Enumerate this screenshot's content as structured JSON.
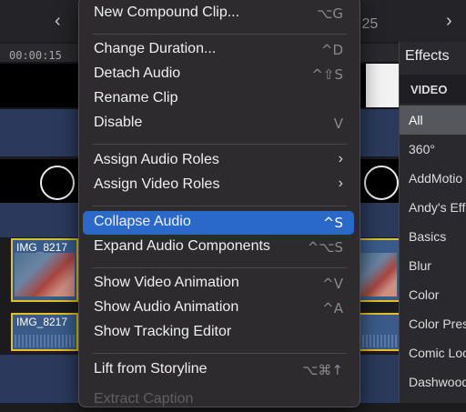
{
  "topbar": {
    "time_text": ":25"
  },
  "ruler": {
    "timecode": "00:00:15"
  },
  "clips": [
    {
      "label": "IMG_8217"
    },
    {
      "label": "IMG_8217"
    }
  ],
  "effects": {
    "title": "Effects",
    "section": "VIDEO",
    "items": [
      "All",
      "360°",
      "AddMotio",
      "Andy's Eff",
      "Basics",
      "Blur",
      "Color",
      "Color Pres",
      "Comic Loo",
      "Dashwood"
    ]
  },
  "menu": {
    "items": [
      {
        "label": "New Compound Clip...",
        "shortcut": "⌥G"
      },
      {
        "label": "Change Duration...",
        "shortcut": "^D"
      },
      {
        "label": "Detach Audio",
        "shortcut": "^⇧S"
      },
      {
        "label": "Rename Clip",
        "shortcut": ""
      },
      {
        "label": "Disable",
        "shortcut": "V"
      },
      {
        "label": "Assign Audio Roles",
        "submenu": "›"
      },
      {
        "label": "Assign Video Roles",
        "submenu": "›"
      },
      {
        "label": "Collapse Audio",
        "shortcut": "^S"
      },
      {
        "label": "Expand Audio Components",
        "shortcut": "^⌥S"
      },
      {
        "label": "Show Video Animation",
        "shortcut": "^V"
      },
      {
        "label": "Show Audio Animation",
        "shortcut": "^A"
      },
      {
        "label": "Show Tracking Editor",
        "shortcut": ""
      },
      {
        "label": "Lift from Storyline",
        "shortcut": "⌥⌘↑"
      },
      {
        "label": "Extract Caption",
        "shortcut": ""
      }
    ]
  },
  "colors": {
    "highlight": "#2b69c8",
    "clip_border": "#e2c027",
    "menu_bg": "#2d2b2e"
  }
}
